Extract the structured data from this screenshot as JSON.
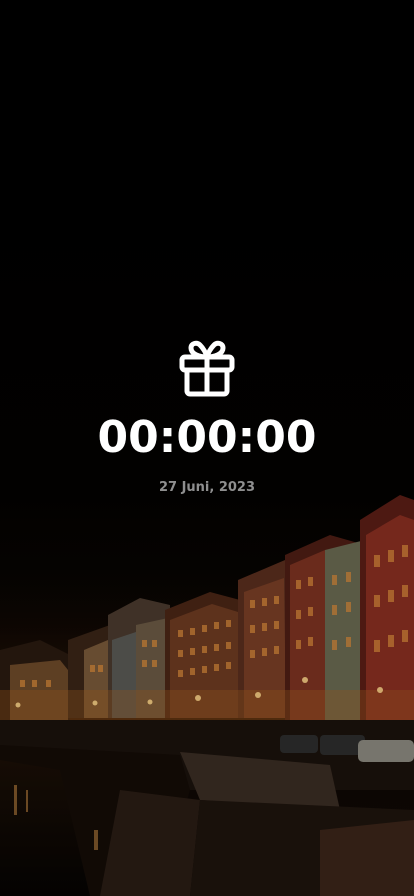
{
  "countdown": {
    "time": "00:00:00",
    "date": "27 Juni, 2023"
  },
  "icons": {
    "gift": "gift-icon"
  },
  "colors": {
    "background": "#000000",
    "countdown_text": "#ffffff",
    "date_text": "#8f8f8f"
  }
}
